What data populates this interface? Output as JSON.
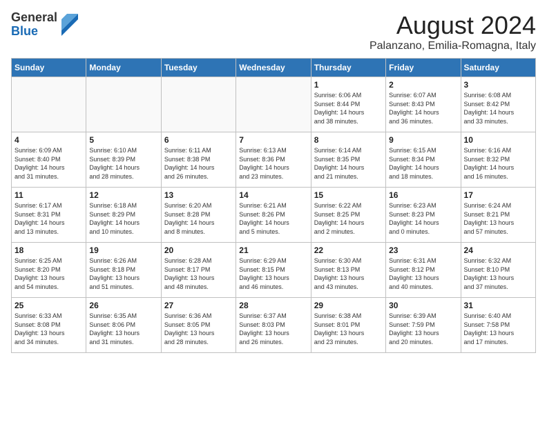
{
  "header": {
    "logo_general": "General",
    "logo_blue": "Blue",
    "month_title": "August 2024",
    "location": "Palanzano, Emilia-Romagna, Italy"
  },
  "weekdays": [
    "Sunday",
    "Monday",
    "Tuesday",
    "Wednesday",
    "Thursday",
    "Friday",
    "Saturday"
  ],
  "weeks": [
    [
      {
        "day": "",
        "info": ""
      },
      {
        "day": "",
        "info": ""
      },
      {
        "day": "",
        "info": ""
      },
      {
        "day": "",
        "info": ""
      },
      {
        "day": "1",
        "info": "Sunrise: 6:06 AM\nSunset: 8:44 PM\nDaylight: 14 hours\nand 38 minutes."
      },
      {
        "day": "2",
        "info": "Sunrise: 6:07 AM\nSunset: 8:43 PM\nDaylight: 14 hours\nand 36 minutes."
      },
      {
        "day": "3",
        "info": "Sunrise: 6:08 AM\nSunset: 8:42 PM\nDaylight: 14 hours\nand 33 minutes."
      }
    ],
    [
      {
        "day": "4",
        "info": "Sunrise: 6:09 AM\nSunset: 8:40 PM\nDaylight: 14 hours\nand 31 minutes."
      },
      {
        "day": "5",
        "info": "Sunrise: 6:10 AM\nSunset: 8:39 PM\nDaylight: 14 hours\nand 28 minutes."
      },
      {
        "day": "6",
        "info": "Sunrise: 6:11 AM\nSunset: 8:38 PM\nDaylight: 14 hours\nand 26 minutes."
      },
      {
        "day": "7",
        "info": "Sunrise: 6:13 AM\nSunset: 8:36 PM\nDaylight: 14 hours\nand 23 minutes."
      },
      {
        "day": "8",
        "info": "Sunrise: 6:14 AM\nSunset: 8:35 PM\nDaylight: 14 hours\nand 21 minutes."
      },
      {
        "day": "9",
        "info": "Sunrise: 6:15 AM\nSunset: 8:34 PM\nDaylight: 14 hours\nand 18 minutes."
      },
      {
        "day": "10",
        "info": "Sunrise: 6:16 AM\nSunset: 8:32 PM\nDaylight: 14 hours\nand 16 minutes."
      }
    ],
    [
      {
        "day": "11",
        "info": "Sunrise: 6:17 AM\nSunset: 8:31 PM\nDaylight: 14 hours\nand 13 minutes."
      },
      {
        "day": "12",
        "info": "Sunrise: 6:18 AM\nSunset: 8:29 PM\nDaylight: 14 hours\nand 10 minutes."
      },
      {
        "day": "13",
        "info": "Sunrise: 6:20 AM\nSunset: 8:28 PM\nDaylight: 14 hours\nand 8 minutes."
      },
      {
        "day": "14",
        "info": "Sunrise: 6:21 AM\nSunset: 8:26 PM\nDaylight: 14 hours\nand 5 minutes."
      },
      {
        "day": "15",
        "info": "Sunrise: 6:22 AM\nSunset: 8:25 PM\nDaylight: 14 hours\nand 2 minutes."
      },
      {
        "day": "16",
        "info": "Sunrise: 6:23 AM\nSunset: 8:23 PM\nDaylight: 14 hours\nand 0 minutes."
      },
      {
        "day": "17",
        "info": "Sunrise: 6:24 AM\nSunset: 8:21 PM\nDaylight: 13 hours\nand 57 minutes."
      }
    ],
    [
      {
        "day": "18",
        "info": "Sunrise: 6:25 AM\nSunset: 8:20 PM\nDaylight: 13 hours\nand 54 minutes."
      },
      {
        "day": "19",
        "info": "Sunrise: 6:26 AM\nSunset: 8:18 PM\nDaylight: 13 hours\nand 51 minutes."
      },
      {
        "day": "20",
        "info": "Sunrise: 6:28 AM\nSunset: 8:17 PM\nDaylight: 13 hours\nand 48 minutes."
      },
      {
        "day": "21",
        "info": "Sunrise: 6:29 AM\nSunset: 8:15 PM\nDaylight: 13 hours\nand 46 minutes."
      },
      {
        "day": "22",
        "info": "Sunrise: 6:30 AM\nSunset: 8:13 PM\nDaylight: 13 hours\nand 43 minutes."
      },
      {
        "day": "23",
        "info": "Sunrise: 6:31 AM\nSunset: 8:12 PM\nDaylight: 13 hours\nand 40 minutes."
      },
      {
        "day": "24",
        "info": "Sunrise: 6:32 AM\nSunset: 8:10 PM\nDaylight: 13 hours\nand 37 minutes."
      }
    ],
    [
      {
        "day": "25",
        "info": "Sunrise: 6:33 AM\nSunset: 8:08 PM\nDaylight: 13 hours\nand 34 minutes."
      },
      {
        "day": "26",
        "info": "Sunrise: 6:35 AM\nSunset: 8:06 PM\nDaylight: 13 hours\nand 31 minutes."
      },
      {
        "day": "27",
        "info": "Sunrise: 6:36 AM\nSunset: 8:05 PM\nDaylight: 13 hours\nand 28 minutes."
      },
      {
        "day": "28",
        "info": "Sunrise: 6:37 AM\nSunset: 8:03 PM\nDaylight: 13 hours\nand 26 minutes."
      },
      {
        "day": "29",
        "info": "Sunrise: 6:38 AM\nSunset: 8:01 PM\nDaylight: 13 hours\nand 23 minutes."
      },
      {
        "day": "30",
        "info": "Sunrise: 6:39 AM\nSunset: 7:59 PM\nDaylight: 13 hours\nand 20 minutes."
      },
      {
        "day": "31",
        "info": "Sunrise: 6:40 AM\nSunset: 7:58 PM\nDaylight: 13 hours\nand 17 minutes."
      }
    ]
  ]
}
